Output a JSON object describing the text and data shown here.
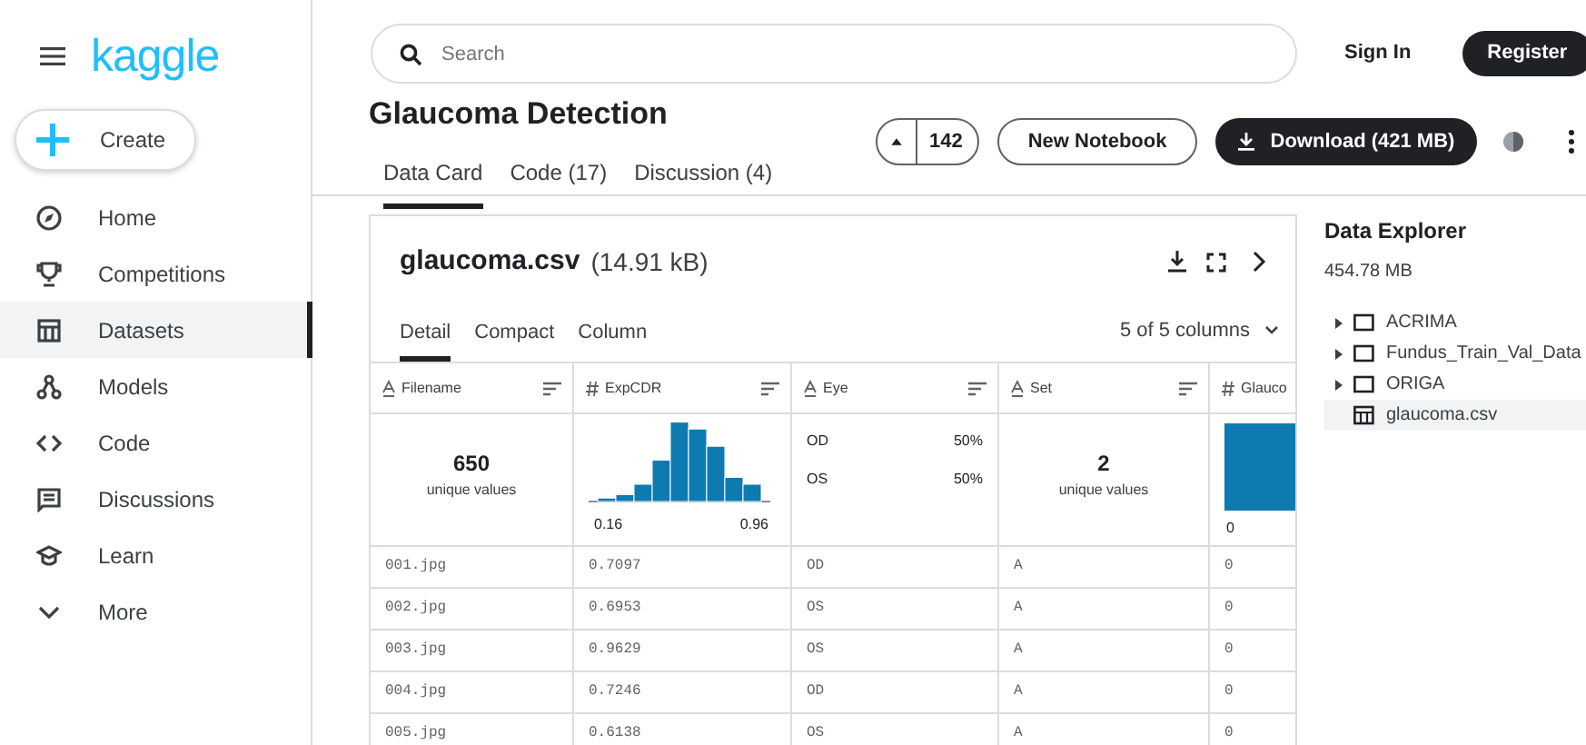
{
  "logo": "kaggle",
  "create_button": "Create",
  "sidebar": {
    "items": [
      {
        "label": "Home",
        "selected": false
      },
      {
        "label": "Competitions",
        "selected": false
      },
      {
        "label": "Datasets",
        "selected": true
      },
      {
        "label": "Models",
        "selected": false
      },
      {
        "label": "Code",
        "selected": false
      },
      {
        "label": "Discussions",
        "selected": false
      },
      {
        "label": "Learn",
        "selected": false
      },
      {
        "label": "More",
        "selected": false
      }
    ]
  },
  "search": {
    "placeholder": "Search"
  },
  "header_actions": {
    "sign_in": "Sign In",
    "register": "Register"
  },
  "dataset": {
    "title": "Glaucoma Detection",
    "tabs": [
      {
        "label": "Data Card",
        "selected": true
      },
      {
        "label": "Code (17)",
        "selected": false
      },
      {
        "label": "Discussion (4)",
        "selected": false
      }
    ],
    "upvotes": "142",
    "new_notebook": "New Notebook",
    "download": "Download (421 MB)"
  },
  "file": {
    "name": "glaucoma.csv",
    "size": "(14.91 kB)",
    "views": [
      {
        "label": "Detail",
        "selected": true
      },
      {
        "label": "Compact",
        "selected": false
      },
      {
        "label": "Column",
        "selected": false
      }
    ],
    "columns_selector": "5 of 5 columns",
    "table": {
      "columns": [
        {
          "name": "Filename",
          "kind": "string"
        },
        {
          "name": "ExpCDR",
          "kind": "number"
        },
        {
          "name": "Eye",
          "kind": "string"
        },
        {
          "name": "Set",
          "kind": "string"
        },
        {
          "name": "Glauco",
          "kind": "number"
        }
      ],
      "summary": [
        {
          "kind": "unique",
          "count": "650",
          "label": "unique values"
        },
        {
          "kind": "histogram",
          "min": "0.16",
          "max": "0.96"
        },
        {
          "kind": "categories",
          "items": [
            {
              "label": "OD",
              "share": "50%"
            },
            {
              "label": "OS",
              "share": "50%"
            }
          ]
        },
        {
          "kind": "unique",
          "count": "2",
          "label": "unique values"
        },
        {
          "kind": "bar",
          "min": "0"
        }
      ],
      "rows": [
        [
          "001.jpg",
          "0.7097",
          "OD",
          "A",
          "0"
        ],
        [
          "002.jpg",
          "0.6953",
          "OS",
          "A",
          "0"
        ],
        [
          "003.jpg",
          "0.9629",
          "OS",
          "A",
          "0"
        ],
        [
          "004.jpg",
          "0.7246",
          "OD",
          "A",
          "0"
        ],
        [
          "005.jpg",
          "0.6138",
          "OS",
          "A",
          "0"
        ]
      ]
    }
  },
  "data_explorer": {
    "title": "Data Explorer",
    "size": "454.78 MB",
    "tree": [
      {
        "label": "ACRIMA",
        "kind": "folder",
        "selected": false
      },
      {
        "label": "Fundus_Train_Val_Data",
        "kind": "folder",
        "selected": false
      },
      {
        "label": "ORIGA",
        "kind": "folder",
        "selected": false
      },
      {
        "label": "glaucoma.csv",
        "kind": "table",
        "selected": true
      }
    ]
  }
}
